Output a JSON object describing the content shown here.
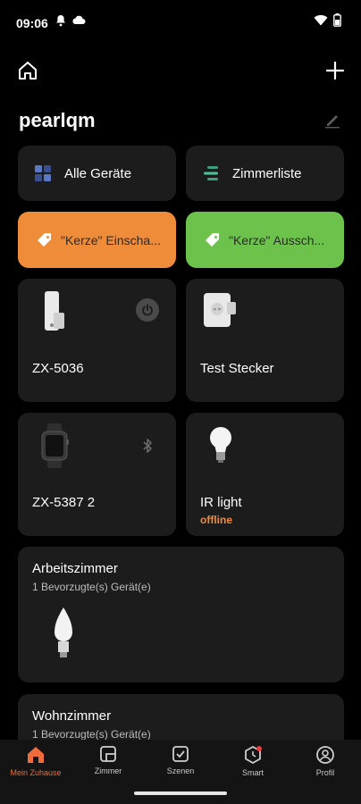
{
  "status_bar": {
    "time": "09:06"
  },
  "header": {
    "home_name": "pearlqm"
  },
  "shortcuts": [
    {
      "label": "Alle Geräte",
      "icon": "grid-icon"
    },
    {
      "label": "Zimmerliste",
      "icon": "list-icon"
    }
  ],
  "scenes": [
    {
      "label": "\"Kerze\" Einscha...",
      "color": "#ef8c3a"
    },
    {
      "label": "\"Kerze\" Aussch...",
      "color": "#6cc24a"
    }
  ],
  "devices": [
    {
      "name": "ZX-5036",
      "status": "",
      "icon": "camera-device-icon",
      "action": "power-icon"
    },
    {
      "name": "Test Stecker",
      "status": "",
      "icon": "plug-device-icon",
      "action": ""
    },
    {
      "name": "ZX-5387 2",
      "status": "",
      "icon": "smartwatch-device-icon",
      "action": "bluetooth-icon"
    },
    {
      "name": "IR light",
      "status": "offline",
      "icon": "bulb-device-icon",
      "action": ""
    }
  ],
  "rooms": [
    {
      "title": "Arbeitszimmer",
      "subtitle": "1 Bevorzugte(s) Gerät(e)"
    },
    {
      "title": "Wohnzimmer",
      "subtitle": "1 Bevorzugte(s) Gerät(e)"
    }
  ],
  "nav": [
    {
      "label": "Mein Zuhause",
      "icon": "home-icon",
      "active": true
    },
    {
      "label": "Zimmer",
      "icon": "room-icon",
      "active": false
    },
    {
      "label": "Szenen",
      "icon": "scene-check-icon",
      "active": false
    },
    {
      "label": "Smart",
      "icon": "smart-icon",
      "active": false
    },
    {
      "label": "Profil",
      "icon": "profile-icon",
      "active": false
    }
  ],
  "colors": {
    "accent": "#ef6b3a",
    "card": "#1c1c1c",
    "offline": "#ef8c3a"
  }
}
